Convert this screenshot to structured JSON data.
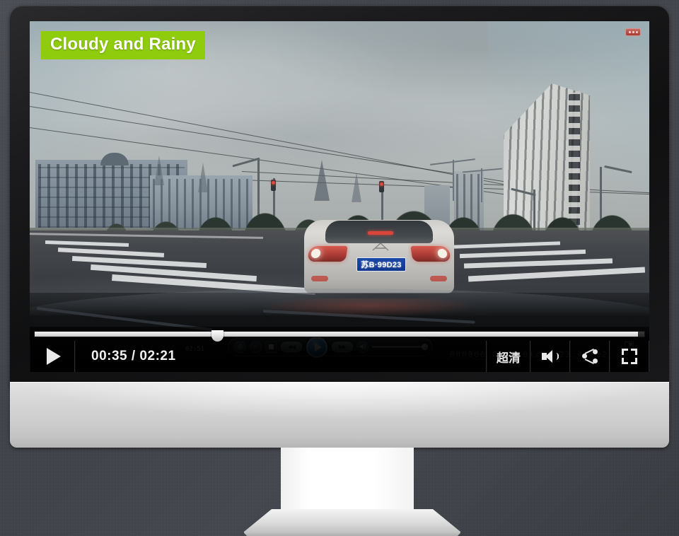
{
  "weather_banner": {
    "text": "Cloudy and Rainy",
    "background_color": "#8fcc0d",
    "text_color": "#ffffff"
  },
  "video_scene": {
    "description": "Dashcam view of wet road at intersection behind silver sedan",
    "license_plate": "苏B·99D23",
    "sky": "overcast gray",
    "osd_timestamp": "000000  2000/01/07  23:48:02",
    "rec_indicator_label": "REC",
    "sdcard_icon": "sdcard-icon"
  },
  "inner_player": {
    "time_label": "02:51",
    "buttons": [
      {
        "name": "snapshot",
        "glyph": "◎"
      },
      {
        "name": "record",
        "glyph": "○"
      },
      {
        "name": "stop",
        "glyph": "■"
      },
      {
        "name": "rewind",
        "glyph": "◀◀"
      },
      {
        "name": "play",
        "glyph": "▶"
      },
      {
        "name": "forward",
        "glyph": "▶▶"
      },
      {
        "name": "volume",
        "glyph": "◀))"
      }
    ],
    "volume_level": 95
  },
  "player_controls": {
    "play_label": "play",
    "time_current": "00:35",
    "time_separator": "/",
    "time_total": "02:21",
    "time_display": "00:35 / 02:21",
    "quality_label": "超清",
    "volume_label": "volume",
    "share_label": "share",
    "fullscreen_label": "fullscreen",
    "progress_percent": 25,
    "buffer_percent": 99
  },
  "device": {
    "type": "desktop-monitor",
    "bezel_color": "#101011",
    "base_color": "#d8d8d8"
  }
}
